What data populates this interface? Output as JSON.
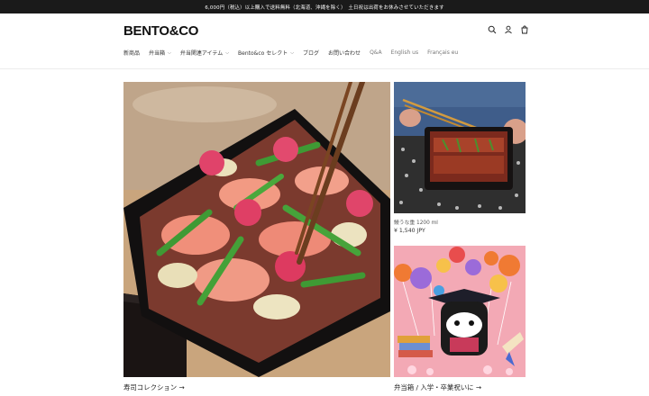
{
  "announcement": "6,000円（税込）以上購入で送料無料（北海道、沖縄を除く）　土日祝は出荷をお休みさせていただきます",
  "brand": {
    "logo": "BENTO&CO"
  },
  "header_icons": [
    "search-icon",
    "account-icon",
    "cart-icon"
  ],
  "nav": {
    "items": [
      {
        "label": "新商品",
        "dropdown": false
      },
      {
        "label": "弁当箱",
        "dropdown": true
      },
      {
        "label": "弁当関連アイテム",
        "dropdown": true
      },
      {
        "label": "Bento&co セレクト",
        "dropdown": true
      },
      {
        "label": "ブログ",
        "dropdown": false
      },
      {
        "label": "お問い合わせ",
        "dropdown": false
      },
      {
        "label": "Q&A",
        "dropdown": false
      },
      {
        "label": "English us",
        "dropdown": false
      },
      {
        "label": "Français eu",
        "dropdown": false
      }
    ]
  },
  "main_feature": {
    "caption": "寿司コレクション →"
  },
  "product": {
    "name": "鰻うな重 1200 ml",
    "price": "¥ 1,540 JPY"
  },
  "side_feature": {
    "caption": "弁当箱 / 入学・卒業祝いに →"
  },
  "colors": {
    "announce_bg": "#1a1a1a",
    "text": "#1a1a1a",
    "accent_pink": "#f3a9b5"
  }
}
